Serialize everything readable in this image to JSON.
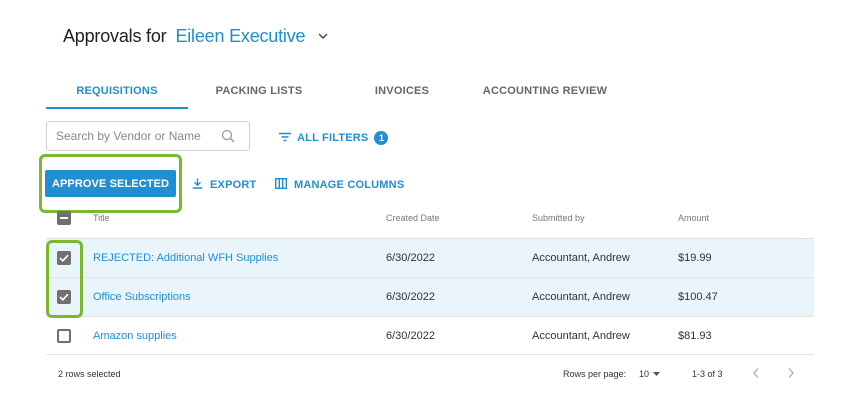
{
  "header": {
    "prefix": "Approvals for",
    "user_name": "Eileen Executive"
  },
  "tabs": [
    {
      "label": "REQUISITIONS",
      "active": true
    },
    {
      "label": "PACKING LISTS",
      "active": false
    },
    {
      "label": "INVOICES",
      "active": false
    },
    {
      "label": "ACCOUNTING REVIEW",
      "active": false
    }
  ],
  "search": {
    "placeholder": "Search by Vendor or Name",
    "value": ""
  },
  "filters": {
    "label": "ALL FILTERS",
    "count": "1"
  },
  "toolbar": {
    "approve_label": "APPROVE SELECTED",
    "export_label": "EXPORT",
    "manage_columns_label": "MANAGE COLUMNS"
  },
  "table": {
    "columns": [
      "Title",
      "Created Date",
      "Submitted by",
      "Amount"
    ],
    "rows": [
      {
        "title": "REJECTED: Additional WFH Supplies",
        "created": "6/30/2022",
        "submitted_by": "Accountant, Andrew",
        "amount": "$19.99",
        "selected": true
      },
      {
        "title": "Office Subscriptions",
        "created": "6/30/2022",
        "submitted_by": "Accountant, Andrew",
        "amount": "$100.47",
        "selected": true
      },
      {
        "title": "Amazon supplies",
        "created": "6/30/2022",
        "submitted_by": "Accountant, Andrew",
        "amount": "$81.93",
        "selected": false
      }
    ]
  },
  "footer": {
    "selected_text": "2 rows selected",
    "rows_per_page_label": "Rows per page:",
    "rows_per_page_value": "10",
    "range_text": "1-3 of 3"
  },
  "colors": {
    "accent": "#1f8fd1",
    "highlight": "#7cb82f",
    "selected_row": "#eaf4fb"
  }
}
